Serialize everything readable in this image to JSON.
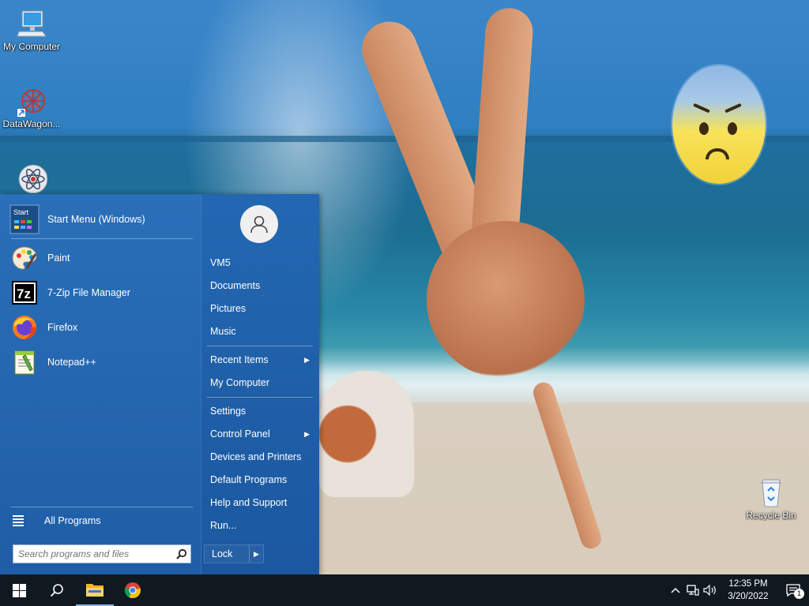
{
  "desktop": {
    "icons": [
      {
        "label": "My Computer",
        "icon": "monitor-icon"
      },
      {
        "label": "DataWagon...",
        "icon": "datawagon-icon"
      },
      {
        "label": "",
        "icon": "atom-app-icon"
      },
      {
        "label": "Recycle Bin",
        "icon": "recycle-bin-icon"
      }
    ]
  },
  "start_menu": {
    "apps": [
      {
        "label": "Start Menu (Windows)",
        "icon": "start-menu-app-icon"
      },
      {
        "label": "Paint",
        "icon": "paint-palette-icon"
      },
      {
        "label": "7-Zip File Manager",
        "icon": "seven-zip-icon"
      },
      {
        "label": "Firefox",
        "icon": "firefox-icon"
      },
      {
        "label": "Notepad++",
        "icon": "notepad-plus-plus-icon"
      }
    ],
    "start_icon_text": "Start",
    "seven_zip_text": "7z",
    "all_programs": "All Programs",
    "search_placeholder": "Search programs and files",
    "user_links": [
      {
        "label": "VM5"
      },
      {
        "label": "Documents"
      },
      {
        "label": "Pictures"
      },
      {
        "label": "Music"
      }
    ],
    "nav_links": [
      {
        "label": "Recent Items",
        "submenu": true
      },
      {
        "label": "My Computer",
        "submenu": false
      }
    ],
    "system_links": [
      {
        "label": "Settings",
        "submenu": false
      },
      {
        "label": "Control Panel",
        "submenu": true
      },
      {
        "label": "Devices and Printers",
        "submenu": false
      },
      {
        "label": "Default Programs",
        "submenu": false
      },
      {
        "label": "Help and Support",
        "submenu": false
      },
      {
        "label": "Run...",
        "submenu": false
      }
    ],
    "lock_label": "Lock"
  },
  "taskbar": {
    "buttons": [
      {
        "name": "windows-start-icon"
      },
      {
        "name": "search-icon"
      },
      {
        "name": "file-explorer-icon"
      },
      {
        "name": "chrome-icon"
      }
    ],
    "clock_time": "12:35 PM",
    "clock_date": "3/20/2022",
    "notification_count": "1"
  },
  "colors": {
    "start_menu_bg": "#1f5fa8",
    "taskbar_bg": "#101820"
  }
}
